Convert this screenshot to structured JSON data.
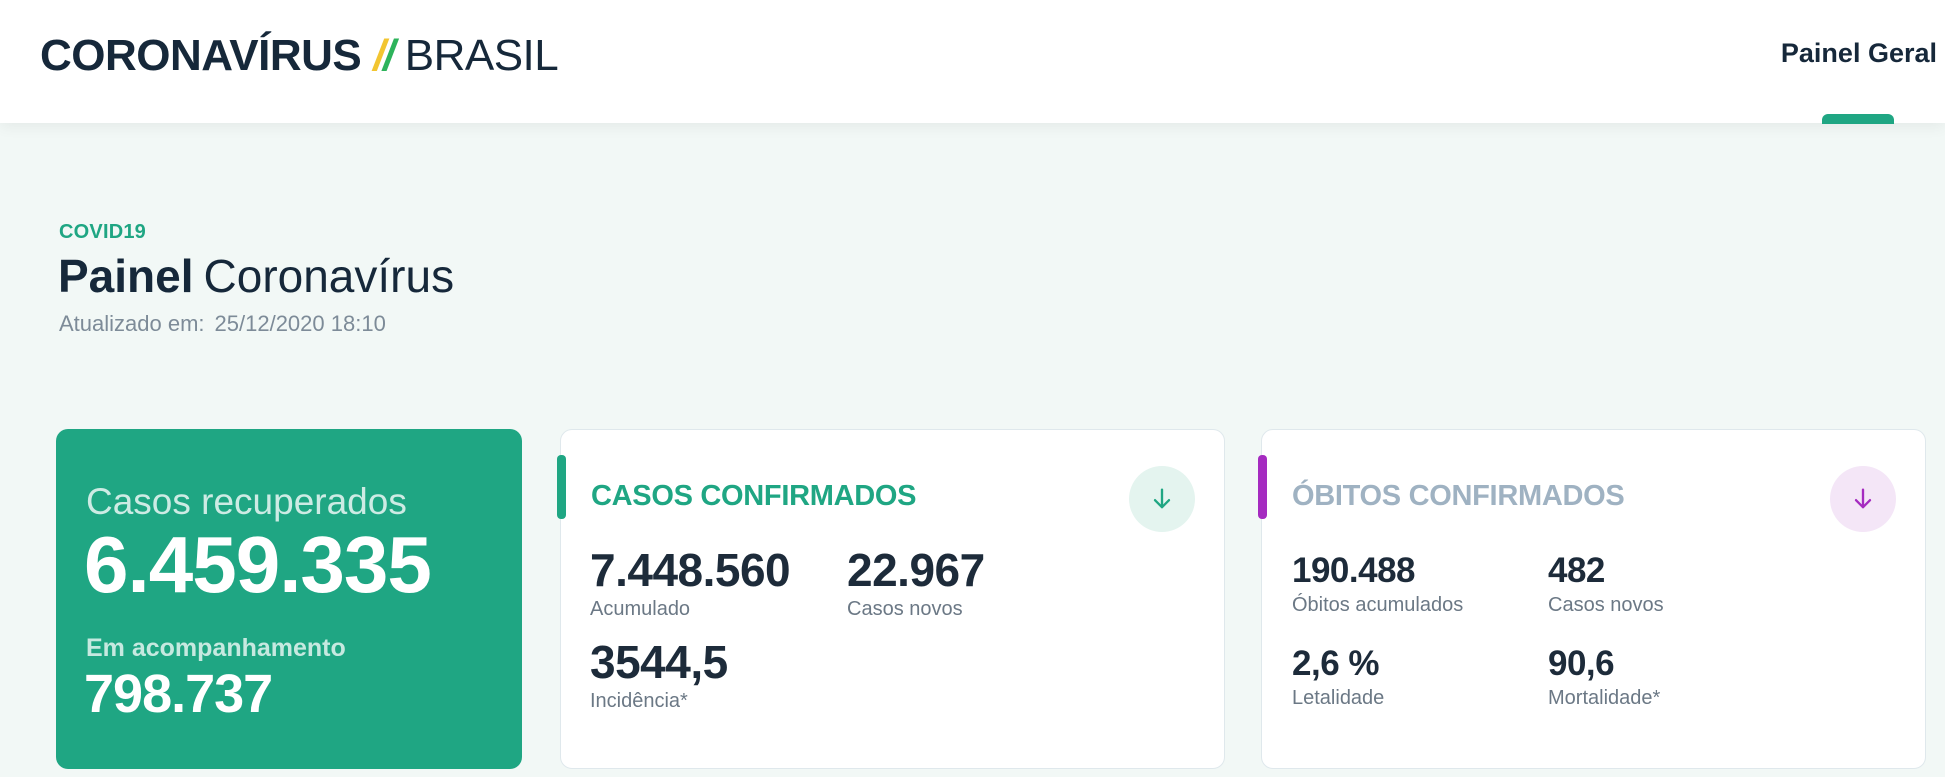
{
  "header": {
    "brand_main": "CORONAVÍRUS",
    "brand_sub": "BRASIL",
    "nav_item": "Painel Geral",
    "accent_yellow": "#f2c531",
    "accent_green": "#2db35b"
  },
  "page": {
    "kicker": "COVID19",
    "title_bold": "Painel",
    "title_light": "Coronavírus",
    "updated_label": "Atualizado em:",
    "updated_value": "25/12/2020 18:10"
  },
  "recovered_card": {
    "label": "Casos recuperados",
    "value": "6.459.335",
    "monitor_label": "Em acompanhamento",
    "monitor_value": "798.737",
    "color": "#1fa683"
  },
  "cases_card": {
    "title": "CASOS CONFIRMADOS",
    "accumulated_value": "7.448.560",
    "accumulated_label": "Acumulado",
    "new_value": "22.967",
    "new_label": "Casos novos",
    "incidence_value": "3544,5",
    "incidence_label": "Incidência*",
    "download_icon": "arrow-down-icon",
    "color": "#1fa683"
  },
  "deaths_card": {
    "title": "ÓBITOS CONFIRMADOS",
    "accumulated_value": "190.488",
    "accumulated_label": "Óbitos acumulados",
    "new_value": "482",
    "new_label": "Casos novos",
    "lethality_value": "2,6 %",
    "lethality_label": "Letalidade",
    "mortality_value": "90,6",
    "mortality_label": "Mortalidade*",
    "download_icon": "arrow-down-icon",
    "color": "#a52bc0"
  }
}
